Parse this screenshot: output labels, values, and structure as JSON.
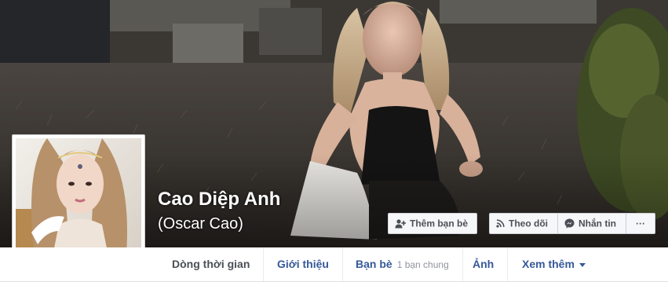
{
  "profile": {
    "name": "Cao Diệp Anh",
    "alternate_name": "(Oscar Cao)"
  },
  "actions": {
    "add_friend": "Thêm bạn bè",
    "follow": "Theo dõi",
    "message": "Nhắn tin",
    "more": "···"
  },
  "tabs": [
    {
      "label": "Dòng thời gian",
      "active": true
    },
    {
      "label": "Giới thiệu"
    },
    {
      "label": "Bạn bè",
      "sub": "1 bạn chung"
    },
    {
      "label": "Ảnh"
    },
    {
      "label": "Xem thêm"
    }
  ],
  "colors": {
    "link_blue": "#365899",
    "nav_bg": "#ffffff",
    "page_bg": "#e9ebee"
  },
  "icons": {
    "add_friend": "add-friend-icon",
    "follow": "rss-icon",
    "message": "messenger-icon",
    "more_tab": "caret-down-icon"
  }
}
